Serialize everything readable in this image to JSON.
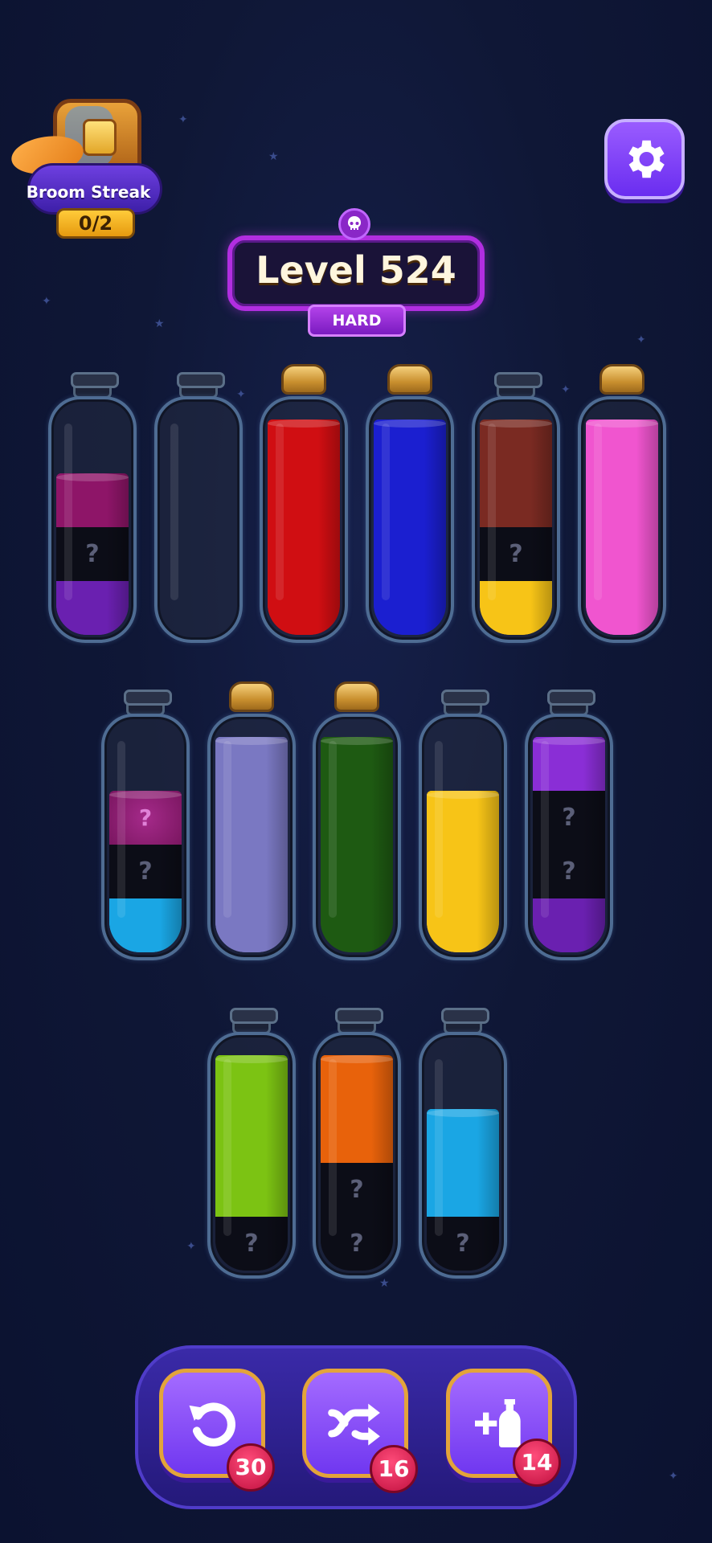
{
  "broom_streak": {
    "label": "Broom Streak",
    "count": "0/2"
  },
  "level": {
    "title": "Level 524",
    "difficulty": "HARD"
  },
  "colors": {
    "magenta": "#8e1568",
    "black": "#0c0d17",
    "purple": "#6a20b0",
    "red": "#d00e12",
    "blue": "#1b1fd0",
    "brown": "#7a2a22",
    "yellow": "#f7c417",
    "pink": "#f055cf",
    "cyan": "#1aa6e4",
    "lavender": "#7a78c2",
    "green": "#1e5a12",
    "lime": "#7cc313",
    "orange": "#e8620b",
    "fizz": "#7a1660",
    "violet": "#8a2ed6"
  },
  "bottles": [
    {
      "corked": false,
      "segments": [
        {
          "color": "magenta",
          "units": 1,
          "q": ""
        },
        {
          "color": "black",
          "units": 1,
          "q": "?"
        },
        {
          "color": "purple",
          "units": 1,
          "q": ""
        }
      ]
    },
    {
      "corked": false,
      "segments": []
    },
    {
      "corked": true,
      "segments": [
        {
          "color": "red",
          "units": 4,
          "q": ""
        }
      ]
    },
    {
      "corked": true,
      "segments": [
        {
          "color": "blue",
          "units": 4,
          "q": ""
        }
      ]
    },
    {
      "corked": false,
      "segments": [
        {
          "color": "brown",
          "units": 2,
          "q": ""
        },
        {
          "color": "black",
          "units": 1,
          "q": "?"
        },
        {
          "color": "yellow",
          "units": 1,
          "q": ""
        }
      ]
    },
    {
      "corked": true,
      "segments": [
        {
          "color": "pink",
          "units": 4,
          "q": ""
        }
      ]
    },
    {
      "corked": false,
      "segments": [
        {
          "color": "fizz",
          "units": 1,
          "q": "?"
        },
        {
          "color": "black",
          "units": 1,
          "q": "?"
        },
        {
          "color": "cyan",
          "units": 1,
          "q": ""
        }
      ]
    },
    {
      "corked": true,
      "segments": [
        {
          "color": "lavender",
          "units": 4,
          "q": ""
        }
      ]
    },
    {
      "corked": true,
      "segments": [
        {
          "color": "green",
          "units": 4,
          "q": ""
        }
      ]
    },
    {
      "corked": false,
      "segments": [
        {
          "color": "yellow",
          "units": 3,
          "q": ""
        }
      ]
    },
    {
      "corked": false,
      "segments": [
        {
          "color": "violet",
          "units": 1,
          "q": ""
        },
        {
          "color": "black",
          "units": 1,
          "q": "?"
        },
        {
          "color": "black",
          "units": 1,
          "q": "?"
        },
        {
          "color": "purple",
          "units": 1,
          "q": ""
        }
      ]
    },
    {
      "corked": false,
      "segments": [
        {
          "color": "lime",
          "units": 3,
          "q": ""
        },
        {
          "color": "black",
          "units": 1,
          "q": "?"
        }
      ]
    },
    {
      "corked": false,
      "segments": [
        {
          "color": "orange",
          "units": 2,
          "q": ""
        },
        {
          "color": "black",
          "units": 1,
          "q": "?"
        },
        {
          "color": "black",
          "units": 1,
          "q": "?"
        }
      ]
    },
    {
      "corked": false,
      "segments": [
        {
          "color": "cyan",
          "units": 2,
          "q": ""
        },
        {
          "color": "black",
          "units": 1,
          "q": "?"
        }
      ]
    }
  ],
  "toolbar": {
    "undo": {
      "icon": "undo-icon",
      "count": "30"
    },
    "shuffle": {
      "icon": "shuffle-icon",
      "count": "16"
    },
    "add_bottle": {
      "icon": "add-bottle-icon",
      "count": "14"
    }
  }
}
